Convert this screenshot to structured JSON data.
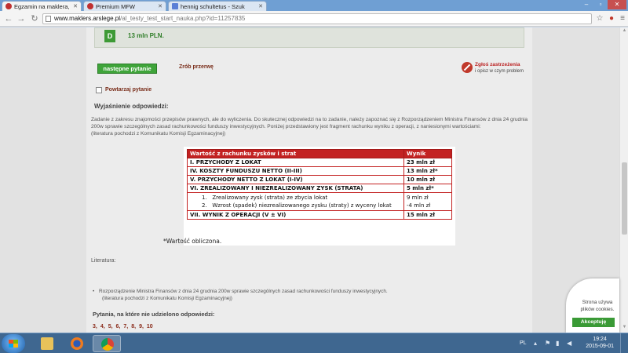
{
  "browser": {
    "tabs": [
      {
        "label": "Egzamin na maklera, test",
        "active": true
      },
      {
        "label": "Premium MFW",
        "active": false
      },
      {
        "label": "hennig schultetus - Szuk",
        "active": false
      }
    ],
    "url_host": "www.maklers.arslege.pl",
    "url_path": "/al_testy_test_start_nauka.php?id=11257835"
  },
  "page": {
    "answer": {
      "letter": "D",
      "text": "13 mln PLN."
    },
    "next_button": "następne pytanie",
    "break_link": "Zrób przerwę",
    "report": {
      "title": "Zgłoś zastrzeżenia",
      "subtitle": "i opisz w czym problem"
    },
    "repeat_label": "Powtarzaj pytanie",
    "explanation_heading": "Wyjaśnienie odpowiedzi:",
    "explanation_text": "Zadanie z zakresu znajomości przepisów prawnych, ale do wyliczenia. Do skutecznej odpowiedzi na to zadanie, należy zapoznać się z Rozporządzeniem Ministra Finansów z dnia 24 grudnia 200w sprawie szczególnych zasad rachunkowości funduszy inwestycyjnych. Poniżej przedstawiony jest fragment rachunku wyniku z operacji, z naniesionymi wartościami:",
    "explanation_source": "(literatura pochodzi z Komunikatu Komisji Egzaminacyjnej)",
    "table": {
      "headers": [
        "Wartość z rachunku zysków i strat",
        "Wynik"
      ],
      "rows": [
        {
          "label": "I. PRZYCHODY Z LOKAT",
          "value": "23 mln zł"
        },
        {
          "label": "IV. KOSZTY FUNDUSZU NETTO (II-III)",
          "value": "13 mln zł*"
        },
        {
          "label": "V. PRZYCHODY NETTO Z LOKAT (I-IV)",
          "value": "10 mln zł"
        },
        {
          "label": "VI. ZREALIZOWANY I NIEZREALIZOWANY ZYSK (STRATA)",
          "value": "5 mln zł*"
        }
      ],
      "sub_items": [
        {
          "label": "1.   Zrealizowany zysk (strata) ze zbycia lokat",
          "value": "9 mln zł"
        },
        {
          "label": "2.   Wzrost (spadek) niezrealizowanego zysku (straty) z wyceny lokat",
          "value": "-4 mln zł"
        }
      ],
      "final_row": {
        "label": "VII. WYNIK Z OPERACJI (V ± VI)",
        "value": "15 mln zł"
      }
    },
    "note": "*Wartość obliczona.",
    "literature_heading": "Literatura:",
    "literature_item": "Rozporządzenie Ministra Finansów z dnia 24 grudnia 200w sprawie szczególnych zasad rachunkowości funduszy inwestycyjnych.",
    "literature_source": "(literatura pochodzi z Komunikatu Komisji Egzaminacyjnej)",
    "unanswered_heading": "Pytania, na które nie udzielono odpowiedzi:",
    "unanswered": [
      "3,",
      "4,",
      "5,",
      "6,",
      "7,",
      "8,",
      "9,",
      "10"
    ]
  },
  "cookie": {
    "text": "Strona używa plików cookies.",
    "accept": "Akceptuję"
  },
  "taskbar": {
    "lang": "PL",
    "time": "19:24",
    "date": "2015-09-01"
  }
}
